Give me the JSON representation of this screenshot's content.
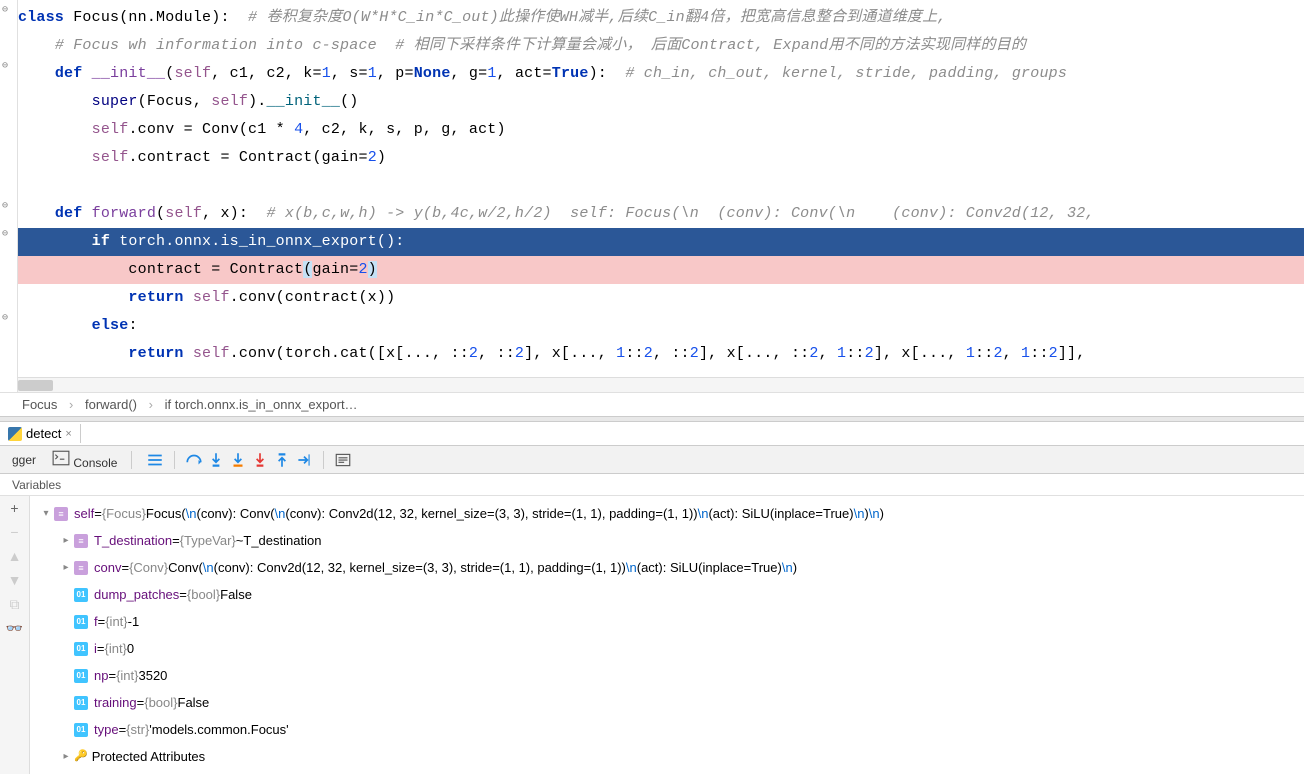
{
  "editor": {
    "lines": [
      {
        "indent": 0,
        "segs": [
          {
            "t": "class ",
            "c": "kw"
          },
          {
            "t": "Focus(nn.Module):  ",
            "c": ""
          },
          {
            "t": "# 卷积复杂度O(W*H*C_in*C_out)此操作使WH减半,后续C_in翻4倍，把宽高信息整合到通道维度上,",
            "c": "cmt"
          }
        ]
      },
      {
        "indent": 1,
        "segs": [
          {
            "t": "# Focus wh information into c-space  # 相同下采样条件下计算量会减小， 后面Contract, Expand用不同的方法实现同样的目的",
            "c": "cmt"
          }
        ]
      },
      {
        "indent": 1,
        "segs": [
          {
            "t": "def ",
            "c": "kw"
          },
          {
            "t": "__init__",
            "c": "fn"
          },
          {
            "t": "(",
            "c": ""
          },
          {
            "t": "self",
            "c": "self"
          },
          {
            "t": ", c1, c2, k=",
            "c": ""
          },
          {
            "t": "1",
            "c": "num"
          },
          {
            "t": ", s=",
            "c": ""
          },
          {
            "t": "1",
            "c": "num"
          },
          {
            "t": ", p=",
            "c": ""
          },
          {
            "t": "None",
            "c": "kw"
          },
          {
            "t": ", g=",
            "c": ""
          },
          {
            "t": "1",
            "c": "num"
          },
          {
            "t": ", act=",
            "c": ""
          },
          {
            "t": "True",
            "c": "kw"
          },
          {
            "t": "):  ",
            "c": ""
          },
          {
            "t": "# ch_in, ch_out, kernel, stride, padding, groups",
            "c": "cmt"
          }
        ]
      },
      {
        "indent": 2,
        "segs": [
          {
            "t": "super",
            "c": "builtin"
          },
          {
            "t": "(Focus, ",
            "c": ""
          },
          {
            "t": "self",
            "c": "self"
          },
          {
            "t": ").",
            "c": ""
          },
          {
            "t": "__init__",
            "c": "fn2"
          },
          {
            "t": "()",
            "c": ""
          }
        ]
      },
      {
        "indent": 2,
        "segs": [
          {
            "t": "self",
            "c": "self"
          },
          {
            "t": ".conv = Conv(c1 * ",
            "c": ""
          },
          {
            "t": "4",
            "c": "num"
          },
          {
            "t": ", c2, k, s, p, g, act)",
            "c": ""
          }
        ]
      },
      {
        "indent": 2,
        "segs": [
          {
            "t": "self",
            "c": "self"
          },
          {
            "t": ".contract = Contract(",
            "c": ""
          },
          {
            "t": "gain",
            "c": ""
          },
          {
            "t": "=",
            "c": ""
          },
          {
            "t": "2",
            "c": "num"
          },
          {
            "t": ")",
            "c": ""
          }
        ]
      },
      {
        "indent": 0,
        "segs": [
          {
            "t": "",
            "c": ""
          }
        ]
      },
      {
        "indent": 1,
        "segs": [
          {
            "t": "def ",
            "c": "kw"
          },
          {
            "t": "forward",
            "c": "fn"
          },
          {
            "t": "(",
            "c": ""
          },
          {
            "t": "self",
            "c": "self"
          },
          {
            "t": ", x):  ",
            "c": ""
          },
          {
            "t": "# x(b,c,w,h) -> y(b,4c,w/2,h/2)  self: Focus(\\n  (conv): Conv(\\n    (conv): Conv2d(12, 32,",
            "c": "cmt"
          }
        ]
      },
      {
        "indent": 2,
        "hl": "blue",
        "segs": [
          {
            "t": "if ",
            "c": "kw"
          },
          {
            "t": "torch.onnx.is_in_onnx_export():",
            "c": ""
          }
        ]
      },
      {
        "indent": 3,
        "hl": "pink",
        "segs": [
          {
            "t": "contract = Contract",
            "c": ""
          },
          {
            "t": "(",
            "c": "paren-match"
          },
          {
            "t": "gain",
            "c": ""
          },
          {
            "t": "=",
            "c": ""
          },
          {
            "t": "2",
            "c": "num"
          },
          {
            "t": ")",
            "c": "paren-match"
          }
        ]
      },
      {
        "indent": 3,
        "segs": [
          {
            "t": "return ",
            "c": "kw"
          },
          {
            "t": "self",
            "c": "self"
          },
          {
            "t": ".conv(contract(x))",
            "c": ""
          }
        ]
      },
      {
        "indent": 2,
        "segs": [
          {
            "t": "else",
            "c": "kw"
          },
          {
            "t": ":",
            "c": ""
          }
        ]
      },
      {
        "indent": 3,
        "segs": [
          {
            "t": "return ",
            "c": "kw"
          },
          {
            "t": "self",
            "c": "self"
          },
          {
            "t": ".conv(torch.cat([x[..., ::",
            "c": ""
          },
          {
            "t": "2",
            "c": "num"
          },
          {
            "t": ", ::",
            "c": ""
          },
          {
            "t": "2",
            "c": "num"
          },
          {
            "t": "], x[..., ",
            "c": ""
          },
          {
            "t": "1",
            "c": "num"
          },
          {
            "t": "::",
            "c": ""
          },
          {
            "t": "2",
            "c": "num"
          },
          {
            "t": ", ::",
            "c": ""
          },
          {
            "t": "2",
            "c": "num"
          },
          {
            "t": "], x[..., ::",
            "c": ""
          },
          {
            "t": "2",
            "c": "num"
          },
          {
            "t": ", ",
            "c": ""
          },
          {
            "t": "1",
            "c": "num"
          },
          {
            "t": "::",
            "c": ""
          },
          {
            "t": "2",
            "c": "num"
          },
          {
            "t": "], x[..., ",
            "c": ""
          },
          {
            "t": "1",
            "c": "num"
          },
          {
            "t": "::",
            "c": ""
          },
          {
            "t": "2",
            "c": "num"
          },
          {
            "t": ", ",
            "c": ""
          },
          {
            "t": "1",
            "c": "num"
          },
          {
            "t": "::",
            "c": ""
          },
          {
            "t": "2",
            "c": "num"
          },
          {
            "t": "]], ",
            "c": ""
          }
        ]
      }
    ]
  },
  "breadcrumb": {
    "p0": "Focus",
    "p1": "forward()",
    "p2": "if torch.onnx.is_in_onnx_export…"
  },
  "tool": {
    "tab_name": "detect",
    "dbg_tab1": "gger",
    "dbg_tab2": "Console",
    "var_header": "Variables"
  },
  "vars": {
    "self": {
      "name": "self",
      "type": "{Focus}",
      "pre": " Focus(",
      "n1": "\\n",
      "s1": "  (conv): Conv(",
      "n2": "\\n",
      "s2": "    (conv): Conv2d(12, 32, kernel_size=(3, 3), stride=(1, 1), padding=(1, 1))",
      "n3": "\\n",
      "s3": "    (act): SiLU(inplace=True)",
      "n4": "\\n",
      "s4": "  )",
      "n5": "\\n",
      "s5": ")"
    },
    "tdest": {
      "name": "T_destination",
      "type": "{TypeVar}",
      "val": " ~T_destination"
    },
    "conv": {
      "name": "conv",
      "type": "{Conv}",
      "pre": " Conv(",
      "n1": "\\n",
      "s1": "  (conv): Conv2d(12, 32, kernel_size=(3, 3), stride=(1, 1), padding=(1, 1))",
      "n2": "\\n",
      "s2": "  (act): SiLU(inplace=True)",
      "n3": "\\n",
      "s3": ")"
    },
    "dump": {
      "name": "dump_patches",
      "type": "{bool}",
      "val": " False"
    },
    "f": {
      "name": "f",
      "type": "{int}",
      "val": " -1"
    },
    "i": {
      "name": "i",
      "type": "{int}",
      "val": " 0"
    },
    "np": {
      "name": "np",
      "type": "{int}",
      "val": " 3520"
    },
    "training": {
      "name": "training",
      "type": "{bool}",
      "val": " False"
    },
    "type": {
      "name": "type",
      "type": "{str}",
      "val": " 'models.common.Focus'"
    },
    "protected": {
      "label": "Protected Attributes"
    }
  }
}
